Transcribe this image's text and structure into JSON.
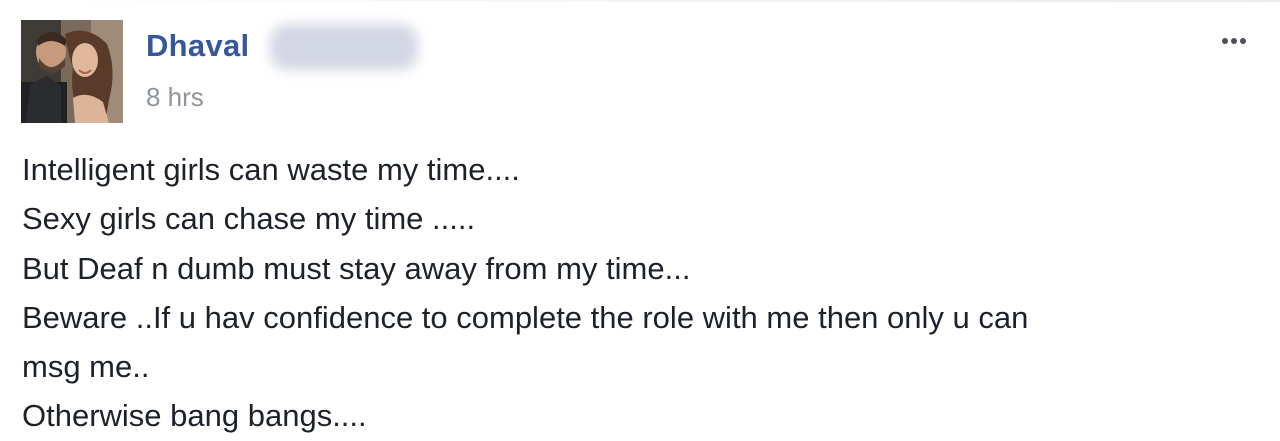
{
  "post": {
    "author_name": "Dhaval",
    "timestamp": "8 hrs",
    "more_icon": "ellipsis-icon",
    "avatar_icon": "profile-photo",
    "lines": [
      "Intelligent girls can waste my time....",
      "Sexy girls can chase my time .....",
      "But Deaf n dumb must stay away from my time...",
      "Beware ..If u hav confidence to complete the role with me then only u can",
      "msg me..",
      "Otherwise bang bangs...."
    ]
  },
  "colors": {
    "author_link": "#365899",
    "timestamp": "#90949c",
    "body_text": "#1d2129",
    "icon": "#4b4f56"
  }
}
